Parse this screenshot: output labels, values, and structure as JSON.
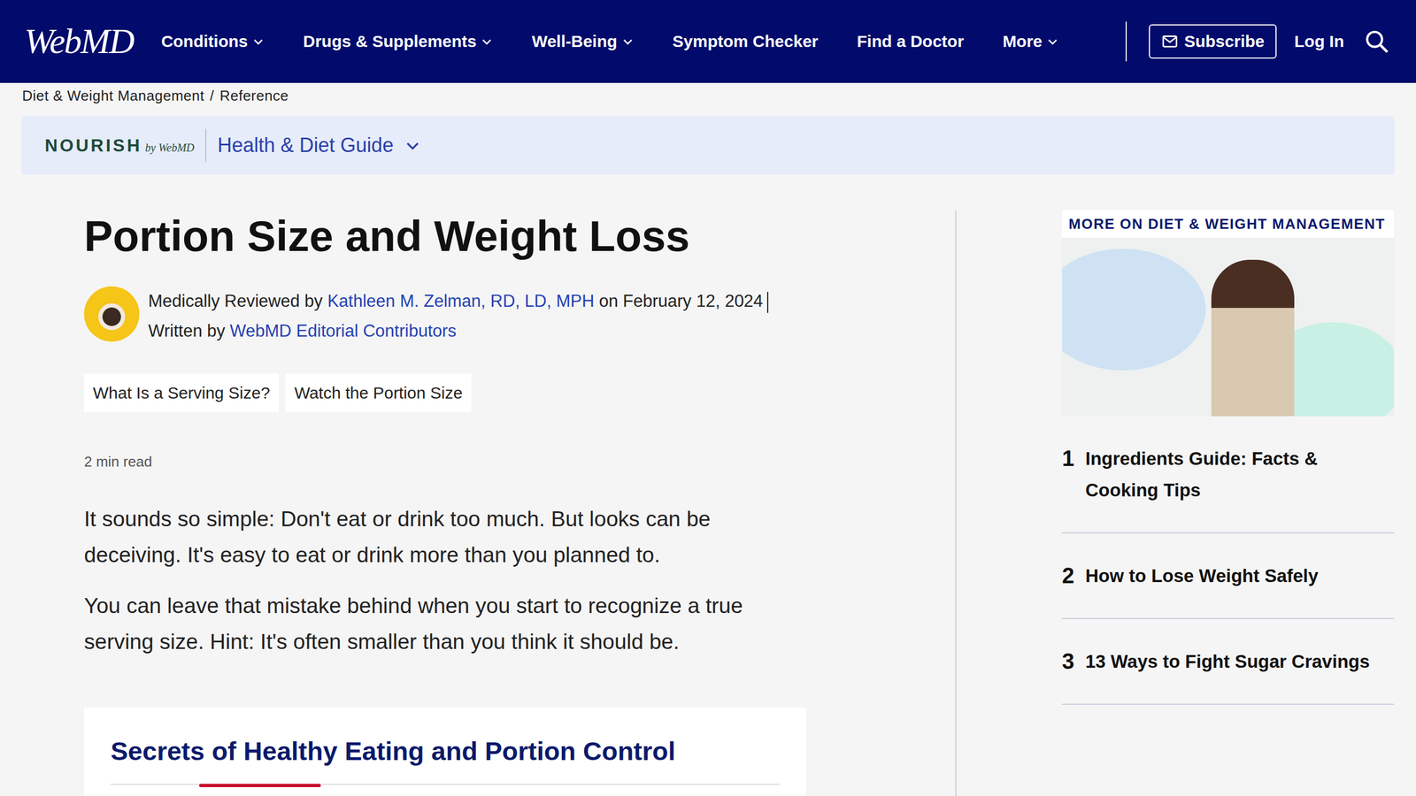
{
  "logo": "WebMD",
  "nav": [
    {
      "label": "Conditions",
      "dropdown": true
    },
    {
      "label": "Drugs & Supplements",
      "dropdown": true
    },
    {
      "label": "Well-Being",
      "dropdown": true
    },
    {
      "label": "Symptom Checker",
      "dropdown": false
    },
    {
      "label": "Find a Doctor",
      "dropdown": false
    },
    {
      "label": "More",
      "dropdown": true
    }
  ],
  "subscribe": "Subscribe",
  "login": "Log In",
  "breadcrumb": {
    "items": [
      "Diet & Weight Management",
      "Reference"
    ],
    "separator": "/"
  },
  "guide": {
    "brand": "NOURISH",
    "brand_by": "by WebMD",
    "label": "Health & Diet Guide"
  },
  "article": {
    "title": "Portion Size and Weight Loss",
    "byline": {
      "reviewed_prefix": "Medically Reviewed by",
      "reviewer": "Kathleen M. Zelman, RD, LD, MPH",
      "date": "on February 12, 2024",
      "written_prefix": "Written by",
      "writer": "WebMD Editorial Contributors"
    },
    "pills": [
      "What Is a Serving Size?",
      "Watch the Portion Size"
    ],
    "read_time": "2 min read",
    "paragraphs": [
      "It sounds so simple: Don't eat or drink too much. But looks can be deceiving. It's easy to eat or drink more than you planned to.",
      "You can leave that mistake behind when you start to recognize a true serving size. Hint: It's often smaller than you think it should be."
    ],
    "card_title": "Secrets of Healthy Eating and Portion Control"
  },
  "sidebar": {
    "heading": "MORE ON DIET & WEIGHT MANAGEMENT",
    "items": [
      {
        "number": "1",
        "title": "Ingredients Guide: Facts & Cooking Tips"
      },
      {
        "number": "2",
        "title": "How to Lose Weight Safely"
      },
      {
        "number": "3",
        "title": "13 Ways to Fight Sugar Cravings"
      }
    ]
  }
}
